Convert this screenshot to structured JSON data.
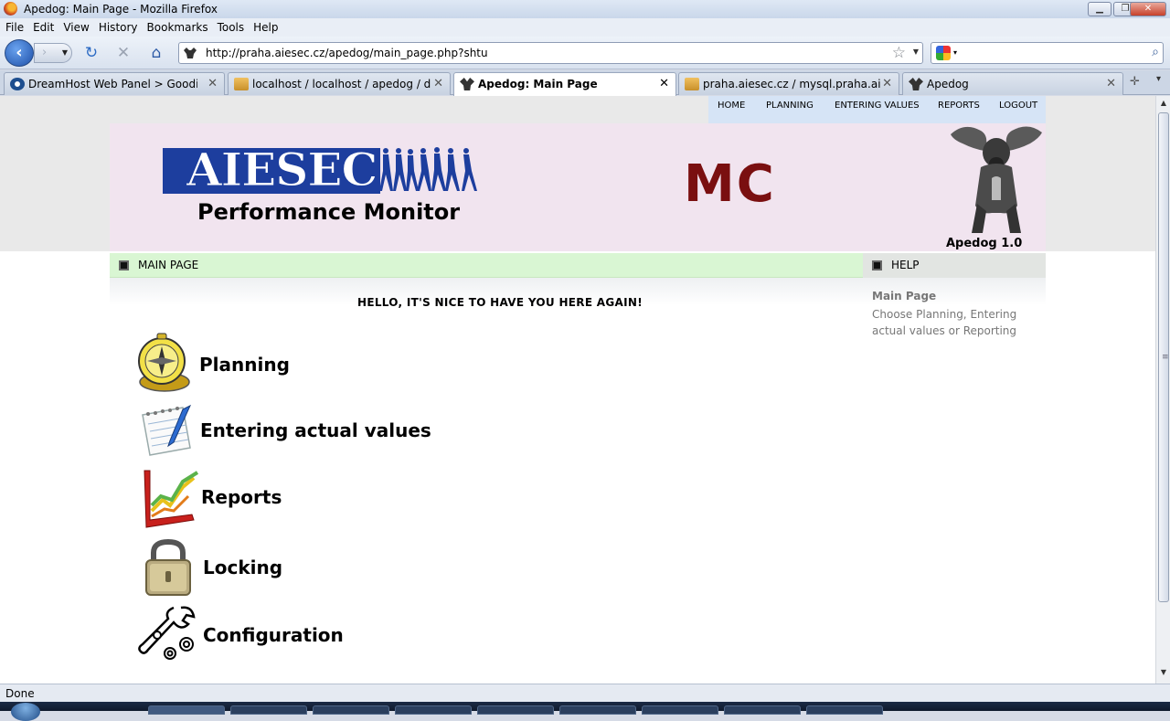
{
  "window": {
    "title": "Apedog: Main Page - Mozilla Firefox"
  },
  "menubar": {
    "items": [
      "File",
      "Edit",
      "View",
      "History",
      "Bookmarks",
      "Tools",
      "Help"
    ]
  },
  "navbar": {
    "url": "http://praha.aiesec.cz/apedog/main_page.php?shtu",
    "search_placeholder": ""
  },
  "tabs": [
    {
      "label": "DreamHost Web Panel > Goodies :...",
      "icon": "dreamhost-icon",
      "active": false
    },
    {
      "label": "localhost / localhost / apedog / de...",
      "icon": "phpmyadmin-icon",
      "active": false
    },
    {
      "label": "Apedog: Main Page",
      "icon": "apedog-icon",
      "active": true
    },
    {
      "label": "praha.aiesec.cz / mysql.praha.aiese...",
      "icon": "phpmyadmin-icon",
      "active": false
    },
    {
      "label": "Apedog",
      "icon": "apedog-icon",
      "active": false
    }
  ],
  "page": {
    "topnav": [
      "HOME",
      "PLANNING",
      "ENTERING VALUES",
      "REPORTS",
      "LOGOUT"
    ],
    "banner": {
      "logo_text": "AIESEC",
      "subtitle": "Performance Monitor",
      "committee": "MC",
      "version": "Apedog 1.0"
    },
    "main_bar_label": "MAIN PAGE",
    "help_bar_label": "HELP",
    "greeting": "HELLO, IT'S NICE TO HAVE YOU HERE AGAIN!",
    "menu": [
      {
        "label": "Planning",
        "icon": "compass-icon"
      },
      {
        "label": "Entering actual values",
        "icon": "notepad-pen-icon"
      },
      {
        "label": "Reports",
        "icon": "chart-icon"
      },
      {
        "label": "Locking",
        "icon": "padlock-icon"
      },
      {
        "label": "Configuration",
        "icon": "wrench-icon"
      }
    ],
    "help": {
      "title": "Main Page",
      "text": "Choose Planning, Entering actual values or Reporting"
    }
  },
  "status": {
    "text": "Done"
  },
  "colors": {
    "banner_bg": "#f1e4ef",
    "aiesec_blue": "#1d3e9e",
    "mc_red": "#7a0f10",
    "mainbar_green": "#d9f6d3",
    "topnav_blue": "#d6e4f6"
  }
}
